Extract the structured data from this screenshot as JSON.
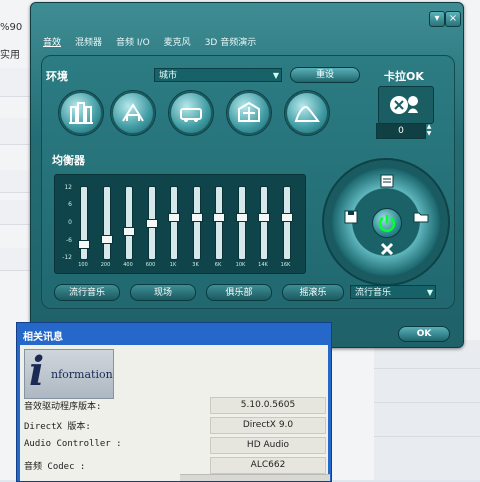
{
  "background": {
    "left_text_1": "%90",
    "left_text_2": "实用"
  },
  "tabs": [
    "音效",
    "混频器",
    "音频 I/O",
    "麦克风",
    "3D 音频演示"
  ],
  "environment": {
    "label": "环境",
    "selected": "城市",
    "reset_label": "重设",
    "icons": [
      "room-icon",
      "hall-icon",
      "vehicle-icon",
      "stadium-icon",
      "opera-house-icon"
    ]
  },
  "karaoke": {
    "label": "卡拉OK",
    "value": "0"
  },
  "equalizer": {
    "label": "均衡器",
    "scale": [
      "12",
      "6",
      "0",
      "-6",
      "-12"
    ],
    "bands": [
      {
        "freq": "100",
        "level": -8
      },
      {
        "freq": "200",
        "level": -6
      },
      {
        "freq": "400",
        "level": -3
      },
      {
        "freq": "600",
        "level": 0
      },
      {
        "freq": "1K",
        "level": 2
      },
      {
        "freq": "3K",
        "level": 2
      },
      {
        "freq": "6K",
        "level": 2
      },
      {
        "freq": "10K",
        "level": 2
      },
      {
        "freq": "14K",
        "level": 2
      },
      {
        "freq": "16K",
        "level": 2
      }
    ],
    "presets": [
      "流行音乐",
      "现场",
      "俱乐部",
      "摇滚乐"
    ],
    "preset_selected": "流行音乐"
  },
  "ok_label": "OK",
  "info_dialog": {
    "title": "相关讯息",
    "logo_text": "nformation",
    "logo_initial": "i",
    "rows": [
      {
        "label": "音效驱动程序版本:",
        "value": "5.10.0.5605"
      },
      {
        "label": "DirectX 版本:",
        "value": "DirectX 9.0"
      },
      {
        "label": "Audio Controller :",
        "value": "HD Audio"
      },
      {
        "label": "音频 Codec :",
        "value": "ALC662"
      }
    ]
  },
  "colors": {
    "panel": "#246c73",
    "dialog_title": "#2568c9"
  }
}
